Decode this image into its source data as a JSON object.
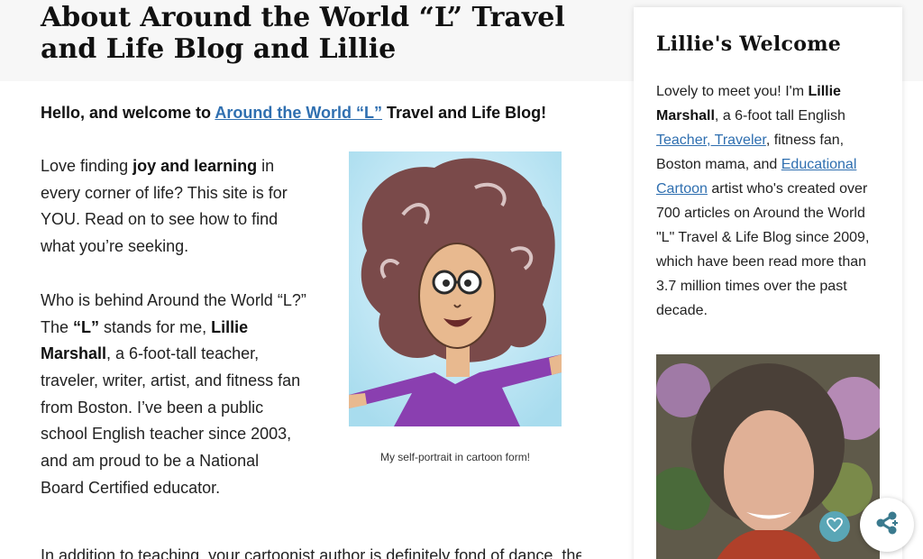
{
  "page": {
    "title": "About Around the World “L” Travel and Life Blog and Lillie"
  },
  "intro": {
    "prefix": "Hello, and welcome to ",
    "link": "Around the World “L”",
    "suffix": " Travel and Life Blog!"
  },
  "body": {
    "p1_a": "Love finding ",
    "p1_bold": "joy and learning",
    "p1_b": " in every corner of life? This site is for YOU. Read on to see how to find what you’re seeking.",
    "p2_a": "Who is behind Around the World “L?” The ",
    "p2_bold1": "“L”",
    "p2_b": " stands for me, ",
    "p2_bold2": "Lillie Marshall",
    "p2_c": ", a 6-foot-tall teacher, traveler, writer, artist, and fitness fan from Boston. I’ve been a public school English teacher since 2003, and am proud to be a National Board Certified educator.",
    "cut_line": "In addition to teaching, your cartoonist author is definitely fond of dance, the"
  },
  "figure": {
    "caption": "My self-portrait in cartoon form!"
  },
  "sidebar": {
    "title": "Lillie's Welcome",
    "t1": "Lovely to meet you! I'm ",
    "t1_bold": "Lillie Marshall",
    "t2": ", a 6-foot tall English ",
    "link1": "Teacher, Traveler",
    "t3": ", fitness fan, Boston mama, and ",
    "link2": "Educational Cartoon",
    "t4": " artist who's created over 700 articles on Around the World \"L\" Travel & Life Blog since 2009, which have been read more than 3.7 million times over the past decade."
  },
  "floating": {
    "heart_icon": "heart-icon",
    "share_icon": "share-icon"
  }
}
